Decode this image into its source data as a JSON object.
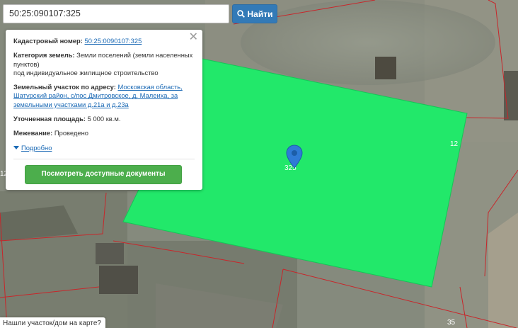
{
  "search": {
    "value": "50:25:090107:325",
    "button_label": "Найти"
  },
  "popup": {
    "cadastral_label": "Кадастровый номер:",
    "cadastral_value": "50:25:0090107:325",
    "category_label": "Категория земель:",
    "category_value": "Земли поселений (земли населенных пунктов)",
    "category_use": "под индивидуальное жилищное строительство",
    "address_label": "Земельный участок по адресу:",
    "address_value": "Московская область, Шатурский район, с/пос Дмитровское, д. Малеиха, за земельными участками д.21а и д.23а",
    "area_label": "Уточненная площадь:",
    "area_value": "5 000 кв.м.",
    "survey_label": "Межевание:",
    "survey_value": "Проведено",
    "more_label": "Подробно",
    "docs_button": "Посмотреть доступные документы",
    "close_glyph": "✕"
  },
  "map": {
    "parcel_color": "#22e86a",
    "boundary_color": "#c8262a",
    "plot_labels": [
      "325",
      "12",
      "12",
      "35"
    ],
    "marker_icon": "map-pin-icon"
  },
  "hint": {
    "text": "Нашли участок/дом на карте?"
  }
}
